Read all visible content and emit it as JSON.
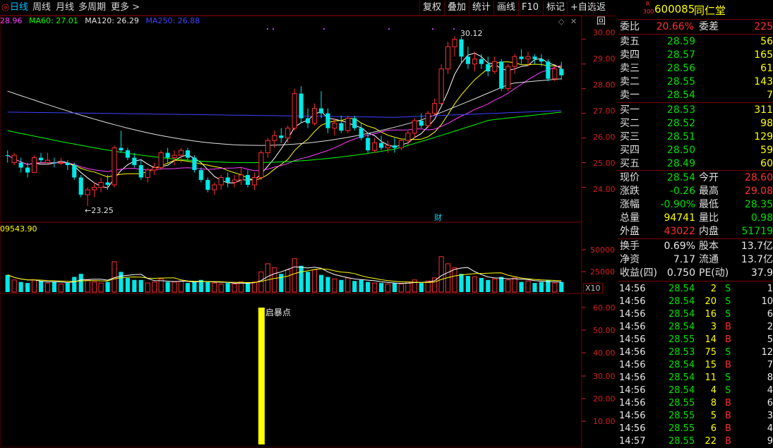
{
  "toolbar": {
    "left_items": [
      "日线",
      "周线",
      "月线",
      "多周期",
      "更多 >"
    ],
    "right_items": [
      "复权",
      "叠加",
      "统计",
      "画线",
      "F10",
      "标记",
      "+自选",
      "返回"
    ]
  },
  "legend": {
    "items": [
      {
        "text": "28.96",
        "color": "#ff40ff"
      },
      {
        "text": "MA60: 27.01",
        "color": "#00ff00"
      },
      {
        "text": "MA120: 26.29",
        "color": "#e0e0e0"
      },
      {
        "text": "MA250: 26.88",
        "color": "#4040ff"
      }
    ]
  },
  "price_axis": [
    "30.00",
    "29.00",
    "28.00",
    "27.00",
    "26.00",
    "25.00",
    "24.00"
  ],
  "annotations": {
    "high": "30.12",
    "low": "23.25",
    "cai": "财"
  },
  "volume": {
    "header": "09543.90",
    "axis": [
      "50000",
      "25000"
    ],
    "unit": "X10"
  },
  "indicator": {
    "label": "启暴点",
    "axis": [
      "60.00",
      "50.00",
      "40.00",
      "30.00",
      "20.00",
      "10.00"
    ]
  },
  "quote": {
    "code": "600085",
    "name": "同仁堂",
    "badge_top": "R",
    "badge_bottom": "300",
    "weibi_label": "委比",
    "weibi": "20.66%",
    "weicha_label": "委差",
    "weicha": "225",
    "asks": [
      {
        "label": "卖五",
        "price": "28.59",
        "vol": "56"
      },
      {
        "label": "卖四",
        "price": "28.57",
        "vol": "165"
      },
      {
        "label": "卖三",
        "price": "28.56",
        "vol": "61"
      },
      {
        "label": "卖二",
        "price": "28.55",
        "vol": "143"
      },
      {
        "label": "卖一",
        "price": "28.54",
        "vol": "7"
      }
    ],
    "bids": [
      {
        "label": "买一",
        "price": "28.53",
        "vol": "311"
      },
      {
        "label": "买二",
        "price": "28.52",
        "vol": "98"
      },
      {
        "label": "买三",
        "price": "28.51",
        "vol": "129"
      },
      {
        "label": "买四",
        "price": "28.50",
        "vol": "59"
      },
      {
        "label": "买五",
        "price": "28.49",
        "vol": "60"
      }
    ],
    "stats": [
      {
        "l1": "现价",
        "v1": "28.54",
        "c1": "green",
        "l2": "今开",
        "v2": "28.60",
        "c2": "red"
      },
      {
        "l1": "涨跌",
        "v1": "-0.26",
        "c1": "green",
        "l2": "最高",
        "v2": "29.08",
        "c2": "red"
      },
      {
        "l1": "涨幅",
        "v1": "-0.90%",
        "c1": "green",
        "l2": "最低",
        "v2": "28.35",
        "c2": "green"
      },
      {
        "l1": "总量",
        "v1": "94741",
        "c1": "yellow",
        "l2": "量比",
        "v2": "0.98",
        "c2": "green"
      },
      {
        "l1": "外盘",
        "v1": "43022",
        "c1": "red",
        "l2": "内盘",
        "v2": "51719",
        "c2": "green"
      }
    ],
    "stats2": [
      {
        "l1": "换手",
        "v1": "0.69%",
        "l2": "股本",
        "v2": "13.7亿"
      },
      {
        "l1": "净资",
        "v1": "7.17",
        "l2": "流通",
        "v2": "13.7亿"
      },
      {
        "l1": "收益(四)",
        "v1": "0.750",
        "l2": "PE(动)",
        "v2": "37.9"
      }
    ],
    "ticks": [
      {
        "t": "14:56",
        "p": "28.54",
        "pc": "green",
        "v": "2",
        "d": "S",
        "n": "1"
      },
      {
        "t": "14:56",
        "p": "28.54",
        "pc": "green",
        "v": "20",
        "d": "S",
        "n": "10"
      },
      {
        "t": "14:56",
        "p": "28.54",
        "pc": "green",
        "v": "16",
        "d": "S",
        "n": "6"
      },
      {
        "t": "14:56",
        "p": "28.54",
        "pc": "green",
        "v": "3",
        "d": "B",
        "n": "2"
      },
      {
        "t": "14:56",
        "p": "28.55",
        "pc": "green",
        "v": "14",
        "d": "B",
        "n": "5"
      },
      {
        "t": "14:56",
        "p": "28.53",
        "pc": "green",
        "v": "75",
        "d": "S",
        "n": "12"
      },
      {
        "t": "14:56",
        "p": "28.54",
        "pc": "green",
        "v": "15",
        "d": "B",
        "n": "7"
      },
      {
        "t": "14:56",
        "p": "28.54",
        "pc": "green",
        "v": "11",
        "d": "S",
        "n": "8"
      },
      {
        "t": "14:56",
        "p": "28.54",
        "pc": "green",
        "v": "4",
        "d": "S",
        "n": "4"
      },
      {
        "t": "14:56",
        "p": "28.55",
        "pc": "green",
        "v": "8",
        "d": "B",
        "n": "6"
      },
      {
        "t": "14:56",
        "p": "28.55",
        "pc": "green",
        "v": "5",
        "d": "B",
        "n": "3"
      },
      {
        "t": "14:56",
        "p": "28.55",
        "pc": "green",
        "v": "6",
        "d": "B",
        "n": "4"
      },
      {
        "t": "14:57",
        "p": "28.55",
        "pc": "green",
        "v": "22",
        "d": "B",
        "n": "9"
      }
    ]
  },
  "chart_data": {
    "type": "candlestick",
    "price_range": [
      23.3,
      30.45
    ],
    "volume_max": 60000,
    "candles": [
      [
        25.3,
        25.5,
        25.0,
        25.3,
        "d"
      ],
      [
        25.3,
        25.4,
        24.9,
        25.0,
        "u"
      ],
      [
        25.0,
        25.2,
        24.6,
        24.8,
        "d"
      ],
      [
        24.8,
        25.0,
        24.4,
        24.6,
        "d"
      ],
      [
        24.6,
        25.3,
        24.6,
        25.2,
        "u"
      ],
      [
        25.2,
        25.4,
        25.0,
        25.1,
        "d"
      ],
      [
        25.1,
        25.4,
        24.9,
        25.0,
        "u"
      ],
      [
        25.0,
        25.2,
        24.8,
        25.0,
        "d"
      ],
      [
        25.0,
        25.2,
        24.9,
        25.0,
        "u"
      ],
      [
        25.0,
        25.1,
        24.7,
        24.9,
        "d"
      ],
      [
        24.9,
        25.0,
        24.3,
        24.4,
        "d"
      ],
      [
        24.4,
        24.5,
        23.6,
        23.7,
        "d"
      ],
      [
        23.7,
        24.0,
        23.25,
        23.9,
        "u"
      ],
      [
        23.9,
        24.2,
        23.6,
        24.0,
        "u"
      ],
      [
        24.0,
        24.4,
        23.8,
        24.2,
        "u"
      ],
      [
        24.2,
        24.5,
        23.9,
        24.1,
        "d"
      ],
      [
        24.1,
        25.7,
        24.0,
        25.6,
        "u"
      ],
      [
        25.6,
        26.3,
        25.4,
        25.5,
        "d"
      ],
      [
        25.5,
        25.6,
        25.1,
        25.2,
        "d"
      ],
      [
        25.2,
        25.4,
        24.8,
        24.9,
        "d"
      ],
      [
        24.9,
        25.1,
        24.3,
        24.4,
        "d"
      ],
      [
        24.4,
        24.8,
        24.2,
        24.7,
        "u"
      ],
      [
        24.7,
        25.0,
        24.5,
        24.8,
        "u"
      ],
      [
        24.8,
        25.5,
        24.7,
        25.4,
        "u"
      ],
      [
        25.4,
        25.6,
        25.0,
        25.2,
        "d"
      ],
      [
        25.2,
        25.5,
        24.9,
        25.3,
        "u"
      ],
      [
        25.3,
        25.6,
        25.0,
        25.5,
        "u"
      ],
      [
        25.5,
        25.6,
        25.1,
        25.2,
        "d"
      ],
      [
        25.2,
        25.3,
        24.6,
        24.7,
        "d"
      ],
      [
        24.7,
        24.8,
        24.2,
        24.3,
        "d"
      ],
      [
        24.3,
        24.4,
        23.8,
        23.9,
        "d"
      ],
      [
        23.9,
        24.2,
        23.7,
        24.1,
        "u"
      ],
      [
        24.1,
        24.5,
        23.9,
        24.4,
        "u"
      ],
      [
        24.4,
        24.6,
        24.0,
        24.2,
        "d"
      ],
      [
        24.2,
        24.5,
        24.0,
        24.3,
        "u"
      ],
      [
        24.3,
        24.8,
        24.1,
        24.5,
        "u"
      ],
      [
        24.5,
        24.7,
        24.0,
        24.1,
        "d"
      ],
      [
        24.1,
        24.6,
        23.9,
        24.4,
        "u"
      ],
      [
        24.4,
        25.5,
        24.3,
        25.4,
        "u"
      ],
      [
        25.4,
        26.0,
        25.2,
        25.9,
        "u"
      ],
      [
        25.9,
        26.3,
        25.6,
        26.1,
        "u"
      ],
      [
        26.1,
        26.4,
        25.8,
        26.0,
        "d"
      ],
      [
        26.0,
        26.5,
        25.8,
        26.4,
        "u"
      ],
      [
        26.4,
        28.0,
        26.3,
        27.8,
        "u"
      ],
      [
        27.8,
        28.1,
        26.6,
        26.8,
        "d"
      ],
      [
        26.8,
        27.2,
        26.4,
        26.6,
        "d"
      ],
      [
        26.6,
        27.4,
        26.5,
        27.2,
        "u"
      ],
      [
        27.2,
        27.9,
        26.8,
        27.0,
        "d"
      ],
      [
        27.0,
        27.2,
        26.2,
        26.4,
        "d"
      ],
      [
        26.4,
        26.8,
        26.1,
        26.6,
        "u"
      ],
      [
        26.6,
        26.9,
        26.2,
        26.3,
        "d"
      ],
      [
        26.3,
        26.9,
        26.2,
        26.8,
        "u"
      ],
      [
        26.8,
        26.9,
        26.3,
        26.4,
        "d"
      ],
      [
        26.4,
        26.6,
        25.9,
        26.0,
        "d"
      ],
      [
        26.0,
        26.2,
        25.4,
        25.5,
        "d"
      ],
      [
        25.5,
        26.0,
        25.4,
        25.8,
        "u"
      ],
      [
        25.8,
        26.1,
        25.5,
        25.6,
        "d"
      ],
      [
        25.6,
        25.9,
        25.4,
        25.7,
        "u"
      ],
      [
        25.7,
        26.0,
        25.4,
        25.6,
        "d"
      ],
      [
        25.6,
        26.0,
        25.5,
        25.9,
        "u"
      ],
      [
        25.9,
        26.3,
        25.7,
        26.2,
        "u"
      ],
      [
        26.2,
        26.8,
        26.0,
        26.7,
        "u"
      ],
      [
        26.7,
        27.0,
        26.4,
        26.5,
        "d"
      ],
      [
        26.5,
        27.1,
        26.4,
        27.0,
        "u"
      ],
      [
        27.0,
        27.6,
        26.9,
        27.4,
        "u"
      ],
      [
        27.4,
        29.0,
        27.3,
        28.8,
        "u"
      ],
      [
        28.8,
        29.9,
        28.6,
        29.7,
        "u"
      ],
      [
        29.7,
        30.12,
        29.3,
        30.0,
        "u"
      ],
      [
        30.0,
        30.1,
        29.0,
        29.3,
        "d"
      ],
      [
        29.3,
        29.7,
        28.8,
        29.0,
        "d"
      ],
      [
        29.0,
        29.5,
        28.7,
        29.2,
        "u"
      ],
      [
        29.2,
        29.4,
        28.8,
        29.0,
        "d"
      ],
      [
        29.0,
        29.3,
        28.5,
        28.7,
        "d"
      ],
      [
        28.7,
        29.3,
        28.6,
        29.1,
        "u"
      ],
      [
        29.1,
        29.2,
        27.9,
        28.0,
        "d"
      ],
      [
        28.0,
        29.0,
        27.9,
        28.9,
        "u"
      ],
      [
        28.9,
        29.4,
        28.6,
        29.3,
        "u"
      ],
      [
        29.3,
        29.6,
        29.0,
        29.2,
        "d"
      ],
      [
        29.2,
        29.5,
        28.9,
        29.3,
        "u"
      ],
      [
        29.3,
        29.4,
        29.0,
        29.2,
        "d"
      ],
      [
        29.2,
        29.4,
        28.9,
        29.1,
        "d"
      ],
      [
        29.1,
        29.2,
        28.3,
        28.4,
        "d"
      ],
      [
        28.4,
        28.9,
        28.3,
        28.8,
        "u"
      ],
      [
        28.8,
        29.08,
        28.35,
        28.54,
        "d"
      ]
    ],
    "volumes": [
      17,
      12,
      10,
      9,
      12,
      11,
      9,
      10,
      8,
      9,
      15,
      18,
      12,
      10,
      9,
      10,
      30,
      20,
      14,
      12,
      12,
      9,
      10,
      13,
      10,
      10,
      11,
      9,
      10,
      12,
      10,
      9,
      8,
      9,
      8,
      10,
      9,
      10,
      20,
      28,
      24,
      18,
      22,
      33,
      26,
      20,
      22,
      17,
      15,
      13,
      12,
      14,
      11,
      12,
      10,
      9,
      9,
      8,
      9,
      8,
      10,
      12,
      9,
      11,
      14,
      35,
      28,
      24,
      18,
      16,
      15,
      14,
      12,
      13,
      15,
      12,
      14,
      10,
      11,
      9,
      10,
      12,
      9,
      10
    ],
    "volume_dir": "from_candles",
    "indicator_bar": {
      "index": 38,
      "value": 60
    }
  }
}
